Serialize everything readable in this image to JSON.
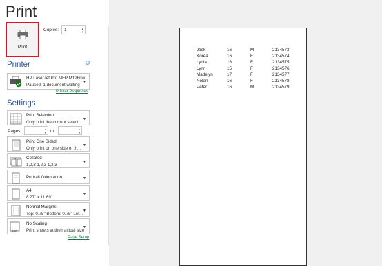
{
  "header": {
    "title": "Print"
  },
  "print_button": {
    "label": "Print"
  },
  "copies": {
    "label": "Copies:",
    "value": "1"
  },
  "printer": {
    "section_title": "Printer",
    "name": "HP LaserJet Pro MFP M126nw",
    "status": "Paused: 1 document waiting",
    "properties_link": "Printer Properties",
    "info_icon": "i"
  },
  "settings": {
    "section_title": "Settings",
    "scope": {
      "title": "Print Selection",
      "subtitle": "Only print the current selecti..."
    },
    "pages": {
      "label": "Pages:",
      "to_label": "to",
      "from_value": "",
      "to_value": ""
    },
    "sides": {
      "title": "Print One Sided",
      "subtitle": "Only print on one side of th..."
    },
    "collation": {
      "title": "Collated",
      "subtitle": "1,2,3    1,2,3    1,2,3"
    },
    "orientation": {
      "title": "Portrait Orientation"
    },
    "paper": {
      "title": "A4",
      "subtitle": "8.27\" x 11.69\""
    },
    "margins": {
      "title": "Normal Margins",
      "subtitle": "Top: 0.75\" Bottom: 0.75\" Lef..."
    },
    "scaling": {
      "title": "No Scaling",
      "subtitle": "Print sheets at their actual size",
      "icon_text": "100"
    },
    "page_setup_link": "Page Setup"
  },
  "preview": {
    "rows": [
      {
        "name": "Jack",
        "age": "16",
        "gender": "M",
        "id": "2134573"
      },
      {
        "name": "Korea",
        "age": "16",
        "gender": "F",
        "id": "2134574"
      },
      {
        "name": "Lydia",
        "age": "16",
        "gender": "F",
        "id": "2134575"
      },
      {
        "name": "Lynn",
        "age": "15",
        "gender": "F",
        "id": "2134576"
      },
      {
        "name": "Madelyn",
        "age": "17",
        "gender": "F",
        "id": "2134577"
      },
      {
        "name": "Nolan",
        "age": "16",
        "gender": "F",
        "id": "2134578"
      },
      {
        "name": "Peter",
        "age": "16",
        "gender": "M",
        "id": "2134579"
      }
    ]
  },
  "colors": {
    "accent": "#2b579a",
    "link": "#217346",
    "highlight": "#e81123"
  }
}
